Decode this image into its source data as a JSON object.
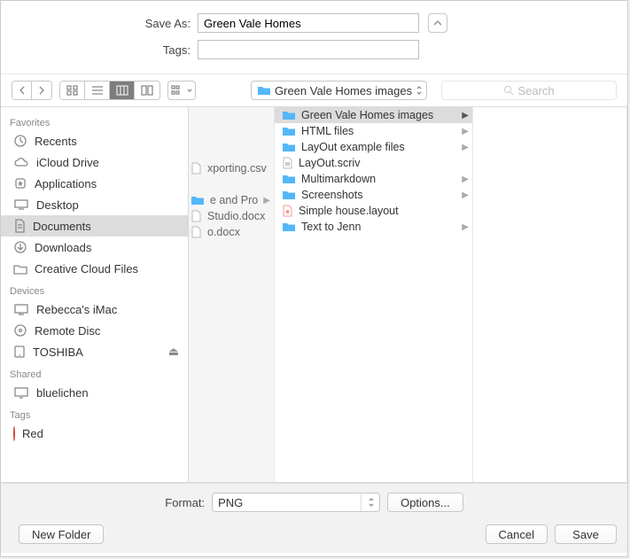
{
  "save_as_label": "Save As:",
  "save_as_value": "Green Vale Homes",
  "tags_label": "Tags:",
  "tags_value": "",
  "path_folder": "Green Vale Homes images",
  "search_placeholder": "Search",
  "sidebar": {
    "sections": [
      {
        "title": "Favorites",
        "items": [
          {
            "label": "Recents",
            "icon": "clock"
          },
          {
            "label": "iCloud Drive",
            "icon": "cloud"
          },
          {
            "label": "Applications",
            "icon": "app"
          },
          {
            "label": "Desktop",
            "icon": "desktop"
          },
          {
            "label": "Documents",
            "icon": "doc",
            "selected": true
          },
          {
            "label": "Downloads",
            "icon": "download"
          },
          {
            "label": "Creative Cloud Files",
            "icon": "folder"
          }
        ]
      },
      {
        "title": "Devices",
        "items": [
          {
            "label": "Rebecca's iMac",
            "icon": "imac"
          },
          {
            "label": "Remote Disc",
            "icon": "disc"
          },
          {
            "label": "TOSHIBA",
            "icon": "hdd",
            "eject": true
          }
        ]
      },
      {
        "title": "Shared",
        "items": [
          {
            "label": "bluelichen",
            "icon": "display"
          }
        ]
      },
      {
        "title": "Tags",
        "items": [
          {
            "label": "Red",
            "icon": "tag",
            "color": "#ff5b4f"
          }
        ]
      }
    ]
  },
  "col1": [
    {
      "label": "xporting.csv",
      "type": "file"
    },
    {
      "label": "",
      "type": "none"
    },
    {
      "label": "e and Pro",
      "type": "folder",
      "arrow": true
    },
    {
      "label": "Studio.docx",
      "type": "file"
    },
    {
      "label": "o.docx",
      "type": "file"
    }
  ],
  "col2": [
    {
      "label": "Green Vale Homes images",
      "type": "folder",
      "arrow": true,
      "selected": true
    },
    {
      "label": "HTML files",
      "type": "folder",
      "arrow": true
    },
    {
      "label": "LayOut example files",
      "type": "folder",
      "arrow": true
    },
    {
      "label": "LayOut.scriv",
      "type": "file-scriv"
    },
    {
      "label": "Multimarkdown",
      "type": "folder",
      "arrow": true
    },
    {
      "label": "Screenshots",
      "type": "folder",
      "arrow": true
    },
    {
      "label": "Simple house.layout",
      "type": "file-layout"
    },
    {
      "label": "Text to Jenn",
      "type": "folder",
      "arrow": true
    }
  ],
  "format_label": "Format:",
  "format_value": "PNG",
  "options_label": "Options...",
  "new_folder_label": "New Folder",
  "cancel_label": "Cancel",
  "save_label": "Save"
}
